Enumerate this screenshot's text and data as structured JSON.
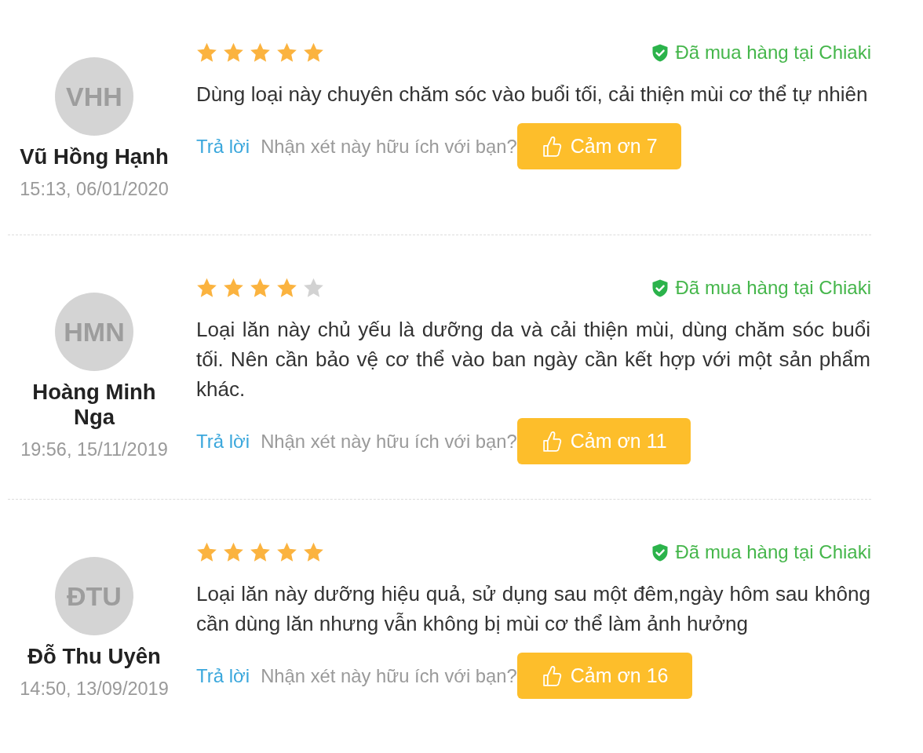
{
  "reviews": [
    {
      "avatar_initials": "VHH",
      "author": "Vũ Hồng Hạnh",
      "date": "15:13, 06/01/2020",
      "stars": 5,
      "purchase_badge": "Đã mua hàng tại Chiaki",
      "comment": "Dùng loại này chuyên chăm sóc vào buổi tối, cải thiện mùi cơ thể tự nhiên",
      "reply_link": "Trả lời",
      "helpful_prompt": "Nhận xét này hữu ích với bạn?",
      "thanks_button": "Cảm ơn 7"
    },
    {
      "avatar_initials": "HMN",
      "author": "Hoàng Minh Nga",
      "date": "19:56, 15/11/2019",
      "stars": 4,
      "purchase_badge": "Đã mua hàng tại Chiaki",
      "comment": "Loại lăn này chủ yếu là dưỡng da và cải thiện mùi, dùng chăm sóc buổi tối. Nên cần bảo vệ cơ thể vào ban ngày cần kết hợp với một sản phẩm khác.",
      "reply_link": "Trả lời",
      "helpful_prompt": "Nhận xét này hữu ích với bạn?",
      "thanks_button": "Cảm ơn 11"
    },
    {
      "avatar_initials": "ĐTU",
      "author": "Đỗ Thu Uyên",
      "date": "14:50, 13/09/2019",
      "stars": 5,
      "purchase_badge": "Đã mua hàng tại Chiaki",
      "comment": "Loại lăn này dưỡng hiệu quả, sử dụng sau một đêm,ngày hôm sau không cần dùng lăn nhưng vẫn không bị mùi cơ thể làm ảnh hưởng",
      "reply_link": "Trả lời",
      "helpful_prompt": "Nhận xét này hữu ích với bạn?",
      "thanks_button": "Cảm ơn 16"
    }
  ]
}
